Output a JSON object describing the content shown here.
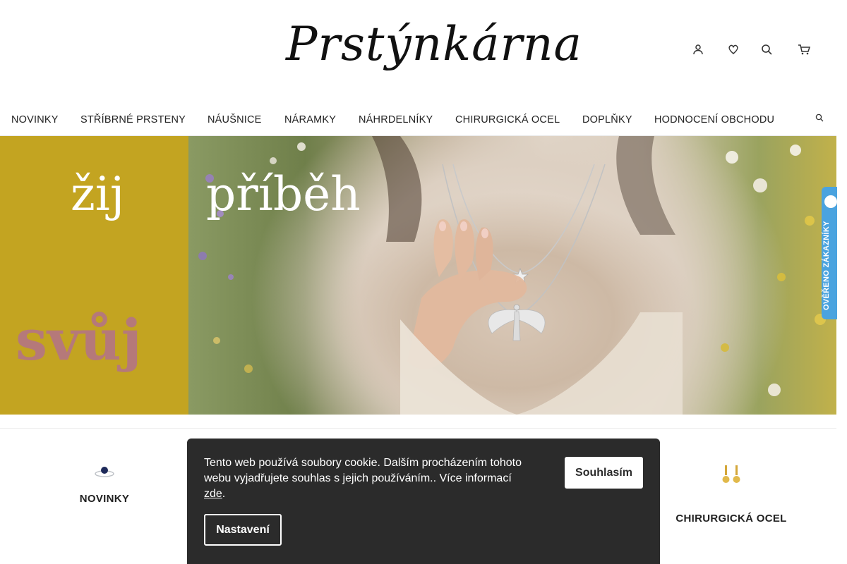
{
  "header": {
    "logo_text": "Prstýnkárna",
    "icons": [
      "user-icon",
      "heart-icon",
      "search-icon",
      "cart-icon"
    ]
  },
  "nav": {
    "items": [
      {
        "label": "NOVINKY"
      },
      {
        "label": "STŘÍBRNÉ PRSTENY"
      },
      {
        "label": "NÁUŠNICE"
      },
      {
        "label": "NÁRAMKY"
      },
      {
        "label": "NÁHRDELNÍKY"
      },
      {
        "label": "CHIRURGICKÁ OCEL"
      },
      {
        "label": "DOPLŇKY"
      },
      {
        "label": "HODNOCENÍ OBCHODU"
      }
    ]
  },
  "hero": {
    "word1": "žij",
    "word2": "příběh",
    "word3": "svůj",
    "left_panel_color": "#c3a421",
    "svuj_color": "#b5797a"
  },
  "badge": {
    "text": "OVĚŘENO ZÁKAZNÍKY",
    "color": "#4aa3df"
  },
  "categories": [
    {
      "label": "NOVINKY",
      "icon": "ring-icon"
    },
    {
      "label": "CHIRURGICKÁ OCEL",
      "icon": "earrings-icon"
    }
  ],
  "cookie": {
    "text": "Tento web používá soubory cookie. Dalším procházením tohoto webu vyjadřujete souhlas s jejich používáním.. Více informací",
    "link_text": "zde",
    "after_link": ".",
    "accept_label": "Souhlasím",
    "settings_label": "Nastavení"
  }
}
